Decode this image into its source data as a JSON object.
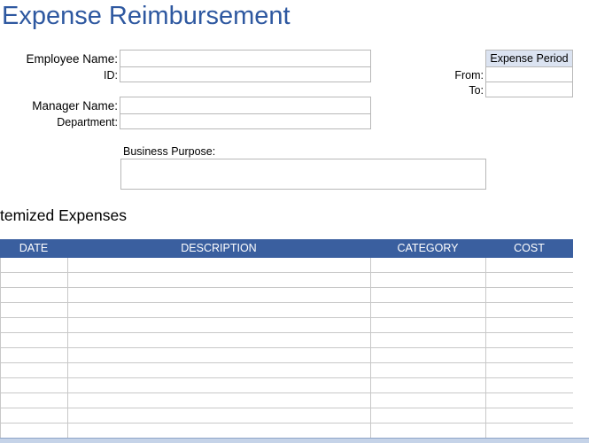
{
  "title": "Expense Reimbursement",
  "form": {
    "employee_name_label": "Employee Name:",
    "id_label": "ID:",
    "manager_name_label": "Manager Name:",
    "department_label": "Department:",
    "business_purpose_label": "Business Purpose:"
  },
  "period": {
    "header": "Expense Period",
    "from_label": "From:",
    "to_label": "To:"
  },
  "itemized": {
    "title": "temized Expenses",
    "columns": [
      "DATE",
      "DESCRIPTION",
      "CATEGORY",
      "COST"
    ]
  },
  "colors": {
    "title": "#2e58a0",
    "table_header": "#3a5f9f",
    "period_header": "#dbe3f1"
  }
}
